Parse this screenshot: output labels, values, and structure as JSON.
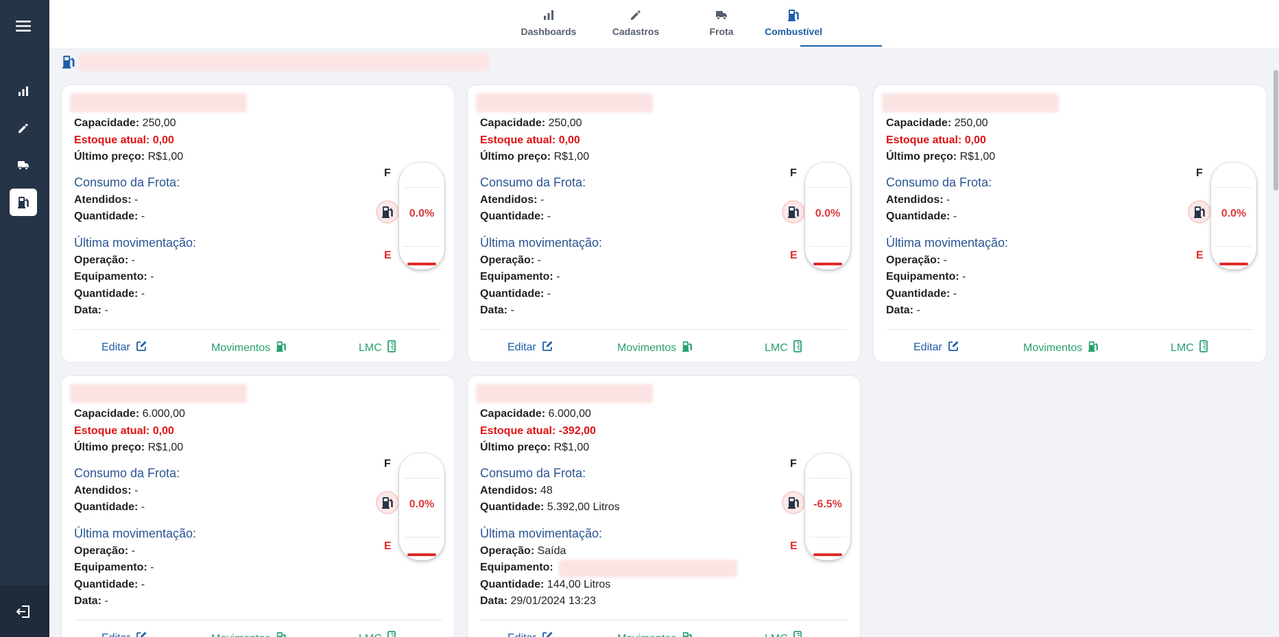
{
  "nav": {
    "tabs": [
      {
        "label": "Dashboards",
        "icon": "bar-chart-icon"
      },
      {
        "label": "Cadastros",
        "icon": "pencil-icon"
      },
      {
        "label": "Frota",
        "icon": "truck-icon"
      },
      {
        "label": "Combustível",
        "icon": "fuel-pump-icon"
      }
    ],
    "active_tab": "Combustível"
  },
  "sidebar": {
    "items": [
      "menu-icon",
      "bar-chart-icon",
      "pencil-icon",
      "truck-icon",
      "fuel-pump-icon",
      "logout-icon"
    ],
    "active": "fuel-pump-icon"
  },
  "labels": {
    "capacidade": "Capacidade:",
    "estoque": "Estoque atual:",
    "ultimo_preco": "Último preço:",
    "consumo": "Consumo da Frota:",
    "atendidos": "Atendidos:",
    "quantidade": "Quantidade:",
    "ultima_mov": "Última movimentação:",
    "operacao": "Operação:",
    "equipamento": "Equipamento:",
    "data": "Data:",
    "full": "F",
    "empty": "E",
    "editar": "Editar",
    "movimentos": "Movimentos",
    "lmc": "LMC"
  },
  "cards": [
    {
      "capacidade": "250,00",
      "estoque": "0,00",
      "ultimo_preco": "R$1,00",
      "atendidos": "-",
      "quantidade": "-",
      "operacao": "-",
      "equipamento": "-",
      "mov_quantidade": "-",
      "data": "-",
      "gauge_pct": "0.0%"
    },
    {
      "capacidade": "250,00",
      "estoque": "0,00",
      "ultimo_preco": "R$1,00",
      "atendidos": "-",
      "quantidade": "-",
      "operacao": "-",
      "equipamento": "-",
      "mov_quantidade": "-",
      "data": "-",
      "gauge_pct": "0.0%"
    },
    {
      "capacidade": "250,00",
      "estoque": "0,00",
      "ultimo_preco": "R$1,00",
      "atendidos": "-",
      "quantidade": "-",
      "operacao": "-",
      "equipamento": "-",
      "mov_quantidade": "-",
      "data": "-",
      "gauge_pct": "0.0%"
    },
    {
      "capacidade": "6.000,00",
      "estoque": "0,00",
      "ultimo_preco": "R$1,00",
      "atendidos": "-",
      "quantidade": "-",
      "operacao": "-",
      "equipamento": "-",
      "mov_quantidade": "-",
      "data": "-",
      "gauge_pct": "0.0%"
    },
    {
      "capacidade": "6.000,00",
      "estoque": "-392,00",
      "ultimo_preco": "R$1,00",
      "atendidos": "48",
      "quantidade": "5.392,00 Litros",
      "operacao": "Saída",
      "equipamento": "",
      "mov_quantidade": "144,00 Litros",
      "data": "29/01/2024 13:23",
      "gauge_pct": "-6.5%"
    }
  ],
  "colors": {
    "sidebar": "#263447",
    "accent": "#1f5ea8",
    "danger": "#e01212",
    "green": "#2aa06f",
    "section": "#2a5593"
  }
}
